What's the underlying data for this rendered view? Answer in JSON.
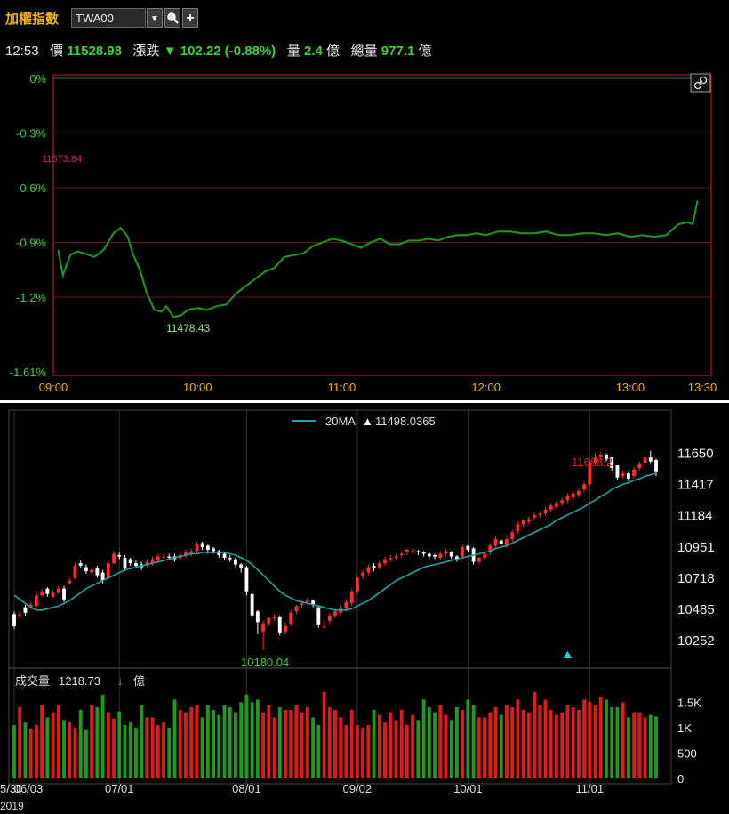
{
  "toolbar": {
    "index_name": "加權指數",
    "symbol": "TWA00",
    "dropdown_glyph": "▼",
    "search_icon": "search-icon",
    "add_glyph": "+"
  },
  "quote": {
    "time": "12:53",
    "price_label": "價",
    "price": "11528.98",
    "change_label": "漲跌",
    "change_arrow": "▼",
    "change": "102.22 (-0.88%)",
    "volume_label": "量",
    "volume": "2.4",
    "volume_unit": "億",
    "total_label": "總量",
    "total": "977.1",
    "total_unit": "億"
  },
  "colors": {
    "up": "#ff2a2a",
    "down_line": "#1e9a1e",
    "ma": "#1aa6a6",
    "grid_red": "#8b1a1a",
    "volume_green": "#1f9a1f",
    "volume_red": "#e01a1a"
  },
  "chart_data": [
    {
      "type": "line",
      "title": "",
      "y_unit": "%",
      "ylim": [
        -1.61,
        0
      ],
      "y_ticks": [
        "0%",
        "-0.3%",
        "-0.6%",
        "-0.9%",
        "-1.2%",
        "-1.61%"
      ],
      "y_tick_values": [
        0,
        -0.3,
        -0.6,
        -0.9,
        -1.2,
        -1.61
      ],
      "x_ticks": [
        "09:00",
        "10:00",
        "11:00",
        "12:00",
        "13:00",
        "13:30"
      ],
      "x_tick_minutes": [
        0,
        60,
        120,
        180,
        240,
        270
      ],
      "reference_label": "11573.84",
      "low_label": "11478.43",
      "series": [
        {
          "minutes": [
            2,
            4,
            7,
            10,
            13,
            17,
            21,
            25,
            28,
            31,
            33,
            36,
            39,
            42,
            45,
            47,
            50,
            53,
            56,
            60,
            64,
            68,
            72,
            76,
            80,
            84,
            88,
            92,
            96,
            100,
            104,
            108,
            112,
            116,
            120,
            124,
            128,
            132,
            136,
            140,
            144,
            148,
            152,
            156,
            160,
            164,
            168,
            172,
            176,
            180,
            185,
            190,
            195,
            200,
            205,
            210,
            215,
            220,
            225,
            230,
            235,
            240,
            245,
            250,
            255,
            260,
            264,
            266,
            268
          ],
          "values": [
            -0.94,
            -1.08,
            -0.97,
            -0.95,
            -0.96,
            -0.98,
            -0.94,
            -0.85,
            -0.82,
            -0.87,
            -0.96,
            -1.05,
            -1.18,
            -1.27,
            -1.28,
            -1.25,
            -1.31,
            -1.3,
            -1.27,
            -1.26,
            -1.27,
            -1.25,
            -1.24,
            -1.18,
            -1.14,
            -1.1,
            -1.06,
            -1.04,
            -0.98,
            -0.97,
            -0.96,
            -0.92,
            -0.9,
            -0.88,
            -0.89,
            -0.91,
            -0.93,
            -0.9,
            -0.88,
            -0.91,
            -0.91,
            -0.89,
            -0.89,
            -0.88,
            -0.89,
            -0.87,
            -0.86,
            -0.86,
            -0.85,
            -0.86,
            -0.84,
            -0.84,
            -0.85,
            -0.85,
            -0.84,
            -0.86,
            -0.86,
            -0.85,
            -0.85,
            -0.86,
            -0.85,
            -0.87,
            -0.86,
            -0.87,
            -0.86,
            -0.8,
            -0.79,
            -0.8,
            -0.67
          ]
        }
      ]
    },
    {
      "type": "candlestick",
      "title": "",
      "ma_label": "20MA",
      "ma_arrow": "▲",
      "ma_value": "11498.0365",
      "ylim": [
        10100,
        11760
      ],
      "y_ticks": [
        "11650",
        "11417",
        "11184",
        "10951",
        "10718",
        "10485",
        "10252"
      ],
      "y_tick_values": [
        11650,
        11417,
        11184,
        10951,
        10718,
        10485,
        10252
      ],
      "x_ticks": [
        "06/03",
        "07/01",
        "08/01",
        "09/02",
        "10/01",
        "11/01"
      ],
      "x_tick_index": [
        0,
        19,
        42,
        62,
        82,
        104
      ],
      "x_year_label": "2019",
      "x_prefix_label": "5/30",
      "high_label": "11668.2",
      "low_label": "10180.04",
      "event_marker_index": 100,
      "open": [
        10450,
        10440,
        10500,
        10500,
        10510,
        10590,
        10640,
        10580,
        10610,
        10640,
        10680,
        10720,
        10830,
        10800,
        10760,
        10790,
        10760,
        10720,
        10830,
        10890,
        10870,
        10860,
        10830,
        10820,
        10820,
        10830,
        10850,
        10880,
        10880,
        10880,
        10870,
        10890,
        10900,
        10920,
        10980,
        10960,
        10940,
        10920,
        10900,
        10870,
        10860,
        10820,
        10800,
        10600,
        10470,
        10320,
        10380,
        10420,
        10430,
        10320,
        10380,
        10470,
        10520,
        10540,
        10550,
        10500,
        10360,
        10400,
        10440,
        10460,
        10490,
        10530,
        10620,
        10730,
        10760,
        10810,
        10800,
        10830,
        10860,
        10870,
        10890,
        10910,
        10920,
        10920,
        10910,
        10900,
        10890,
        10870,
        10900,
        10910,
        10880,
        10880,
        10960,
        10940,
        10840,
        10870,
        10910,
        10960,
        11000,
        10960,
        11010,
        11070,
        11120,
        11140,
        11170,
        11190,
        11200,
        11230,
        11250,
        11280,
        11300,
        11320,
        11340,
        11380,
        11420,
        11580,
        11620,
        11640,
        11620,
        11560,
        11480,
        11500,
        11480,
        11540,
        11580,
        11620,
        11600
      ],
      "close": [
        10360,
        10450,
        10460,
        10520,
        10590,
        10620,
        10600,
        10610,
        10640,
        10560,
        10700,
        10810,
        10810,
        10770,
        10780,
        10740,
        10700,
        10830,
        10900,
        10880,
        10790,
        10830,
        10810,
        10800,
        10840,
        10860,
        10880,
        10880,
        10870,
        10860,
        10890,
        10910,
        10920,
        10970,
        10950,
        10930,
        10920,
        10890,
        10870,
        10860,
        10820,
        10790,
        10620,
        10440,
        10390,
        10380,
        10420,
        10430,
        10310,
        10360,
        10460,
        10510,
        10530,
        10550,
        10520,
        10370,
        10360,
        10440,
        10470,
        10500,
        10540,
        10620,
        10720,
        10760,
        10800,
        10790,
        10830,
        10860,
        10870,
        10880,
        10900,
        10930,
        10920,
        10910,
        10900,
        10880,
        10880,
        10900,
        10920,
        10880,
        10860,
        10950,
        10930,
        10840,
        10870,
        10900,
        10960,
        11010,
        10970,
        11010,
        11060,
        11120,
        11150,
        11160,
        11190,
        11200,
        11230,
        11260,
        11280,
        11300,
        11330,
        11350,
        11370,
        11420,
        11580,
        11620,
        11640,
        11610,
        11540,
        11470,
        11500,
        11460,
        11530,
        11570,
        11620,
        11590,
        11510
      ],
      "high": [
        10470,
        10470,
        10520,
        10540,
        10620,
        10640,
        10650,
        10630,
        10660,
        10660,
        10720,
        10830,
        10850,
        10820,
        10800,
        10810,
        10780,
        10850,
        10920,
        10910,
        10890,
        10870,
        10850,
        10840,
        10860,
        10880,
        10900,
        10900,
        10900,
        10900,
        10910,
        10930,
        10940,
        10990,
        10990,
        10970,
        10950,
        10930,
        10910,
        10890,
        10870,
        10830,
        10810,
        10610,
        10480,
        10400,
        10430,
        10450,
        10440,
        10390,
        10480,
        10520,
        10550,
        10570,
        10560,
        10510,
        10400,
        10460,
        10490,
        10520,
        10560,
        10640,
        10740,
        10780,
        10820,
        10830,
        10850,
        10880,
        10890,
        10900,
        10920,
        10940,
        10940,
        10930,
        10920,
        10910,
        10900,
        10920,
        10940,
        10920,
        10890,
        10970,
        10960,
        10950,
        10880,
        10920,
        10980,
        11030,
        11010,
        11030,
        11080,
        11140,
        11160,
        11180,
        11210,
        11220,
        11250,
        11280,
        11300,
        11320,
        11350,
        11370,
        11390,
        11440,
        11600,
        11650,
        11660,
        11650,
        11620,
        11560,
        11520,
        11510,
        11550,
        11590,
        11640,
        11668,
        11610
      ],
      "low": [
        10340,
        10420,
        10440,
        10490,
        10500,
        10580,
        10580,
        10570,
        10600,
        10540,
        10670,
        10710,
        10790,
        10750,
        10740,
        10720,
        10680,
        10710,
        10820,
        10860,
        10770,
        10810,
        10790,
        10780,
        10800,
        10810,
        10830,
        10860,
        10850,
        10840,
        10850,
        10870,
        10880,
        10900,
        10930,
        10900,
        10900,
        10870,
        10850,
        10840,
        10800,
        10760,
        10590,
        10420,
        10300,
        10180,
        10360,
        10400,
        10290,
        10300,
        10360,
        10450,
        10500,
        10520,
        10500,
        10350,
        10340,
        10380,
        10420,
        10440,
        10470,
        10510,
        10600,
        10710,
        10740,
        10770,
        10780,
        10810,
        10840,
        10850,
        10870,
        10890,
        10900,
        10890,
        10880,
        10860,
        10860,
        10850,
        10880,
        10860,
        10840,
        10860,
        10910,
        10820,
        10820,
        10850,
        10890,
        10940,
        10950,
        10940,
        10990,
        11050,
        11100,
        11120,
        11150,
        11170,
        11180,
        11210,
        11230,
        11260,
        11280,
        11300,
        11320,
        11360,
        11400,
        11560,
        11600,
        11590,
        11520,
        11450,
        11460,
        11440,
        11460,
        11520,
        11560,
        11570,
        11480
      ],
      "ma20": [
        10590,
        10560,
        10530,
        10500,
        10480,
        10480,
        10490,
        10500,
        10510,
        10530,
        10550,
        10580,
        10610,
        10640,
        10660,
        10680,
        10700,
        10720,
        10740,
        10760,
        10780,
        10790,
        10800,
        10810,
        10820,
        10830,
        10840,
        10850,
        10860,
        10870,
        10880,
        10890,
        10900,
        10900,
        10910,
        10910,
        10910,
        10910,
        10910,
        10900,
        10890,
        10870,
        10850,
        10820,
        10780,
        10740,
        10700,
        10660,
        10620,
        10590,
        10570,
        10550,
        10540,
        10530,
        10520,
        10510,
        10500,
        10490,
        10480,
        10480,
        10480,
        10490,
        10510,
        10530,
        10550,
        10580,
        10610,
        10640,
        10670,
        10700,
        10720,
        10740,
        10760,
        10780,
        10800,
        10810,
        10820,
        10830,
        10840,
        10850,
        10860,
        10870,
        10880,
        10890,
        10900,
        10910,
        10920,
        10940,
        10950,
        10960,
        10980,
        11000,
        11020,
        11040,
        11060,
        11080,
        11100,
        11120,
        11150,
        11170,
        11190,
        11210,
        11230,
        11250,
        11280,
        11300,
        11330,
        11350,
        11380,
        11400,
        11420,
        11430,
        11450,
        11460,
        11480,
        11490,
        11500
      ]
    },
    {
      "type": "bar",
      "title": "",
      "label": "成交量",
      "last_value": "1218.73",
      "arrow": "↓",
      "unit": "億",
      "ylim": [
        0,
        1750
      ],
      "y_ticks": [
        "1.5K",
        "1K",
        "500",
        "0"
      ],
      "y_tick_values": [
        1500,
        1000,
        500,
        0
      ],
      "values": [
        1050,
        1400,
        1100,
        980,
        1050,
        1450,
        1200,
        1300,
        1450,
        1150,
        1100,
        1000,
        1350,
        950,
        1450,
        1400,
        1650,
        1300,
        1180,
        1320,
        1050,
        1100,
        1000,
        1450,
        1200,
        1200,
        1050,
        1100,
        1000,
        1550,
        1350,
        1300,
        1400,
        1450,
        1200,
        1450,
        1350,
        1250,
        1450,
        1400,
        1300,
        1500,
        1650,
        1500,
        1550,
        1300,
        1450,
        1200,
        1400,
        1350,
        1350,
        1450,
        1300,
        1400,
        1200,
        1050,
        1700,
        1400,
        1350,
        1200,
        1050,
        1350,
        1050,
        1000,
        1050,
        1350,
        1250,
        1100,
        1300,
        1150,
        1350,
        1050,
        1250,
        1150,
        1550,
        1400,
        1300,
        1450,
        1250,
        1150,
        1400,
        1350,
        1550,
        1450,
        1200,
        1200,
        1300,
        1400,
        1250,
        1450,
        1400,
        1550,
        1350,
        1300,
        1700,
        1450,
        1550,
        1350,
        1250,
        1300,
        1450,
        1400,
        1350,
        1550,
        1500,
        1450,
        1600,
        1550,
        1400,
        1400,
        1500,
        1200,
        1300,
        1300,
        1200,
        1250,
        1218
      ]
    }
  ]
}
